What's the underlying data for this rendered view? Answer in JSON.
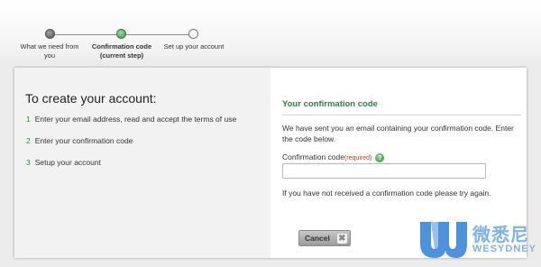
{
  "progress": {
    "steps": [
      {
        "label_line1": "What we need from",
        "label_line2": "you",
        "state": "done"
      },
      {
        "label_line1": "Confirmation code",
        "label_line2": "(current step)",
        "state": "current"
      },
      {
        "label_line1": "Set up your account",
        "label_line2": "",
        "state": "todo"
      }
    ]
  },
  "left": {
    "title": "To create your account:",
    "items": [
      {
        "num": "1",
        "text": "Enter your email address, read and accept the terms of use"
      },
      {
        "num": "2",
        "text": "Enter your confirmation code"
      },
      {
        "num": "3",
        "text": "Setup your account"
      }
    ]
  },
  "right": {
    "title": "Your confirmation code",
    "intro": "We have sent you an email containing your confirmation code. Enter the code below.",
    "field_label": "Confirmation code",
    "field_required": "(required)",
    "help_glyph": "?",
    "field_value": "",
    "retry_text": "If you have not received a confirmation code please try again.",
    "cancel_label": "Cancel",
    "cancel_glyph": "✖"
  },
  "watermark": {
    "name_cn": "微悉尼",
    "name_en": "WESYDNEY",
    "colors": {
      "primary": "#2f7fd6",
      "light": "#7fb2e8"
    }
  },
  "colors": {
    "accent_green": "#2f7f3a",
    "required_red": "#c0392b"
  }
}
